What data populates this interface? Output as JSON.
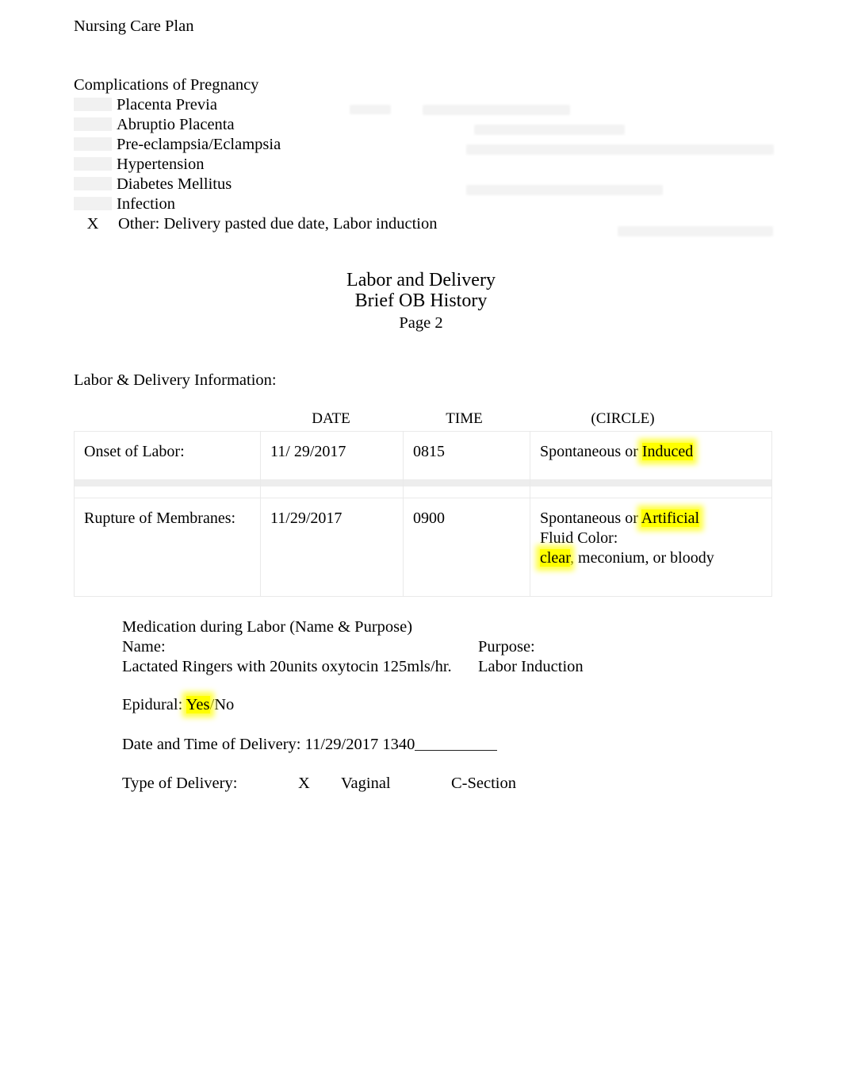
{
  "document": {
    "header": "Nursing Care Plan",
    "title_line_1": "Labor and Delivery",
    "title_line_2": "Brief OB History",
    "page_label": "Page 2"
  },
  "complications": {
    "heading": "Complications of Pregnancy",
    "items": [
      {
        "mark": "",
        "label": "Placenta Previa"
      },
      {
        "mark": "",
        "label": "Abruptio Placenta"
      },
      {
        "mark": "",
        "label": "Pre-eclampsia/Eclampsia"
      },
      {
        "mark": "",
        "label": "Hypertension"
      },
      {
        "mark": "",
        "label": "Diabetes Mellitus"
      },
      {
        "mark": "",
        "label": "Infection"
      }
    ],
    "other": {
      "mark": "X",
      "label": "Other: Delivery pasted due date, Labor induction"
    }
  },
  "labor_section": {
    "label": "Labor & Delivery Information:",
    "columns": [
      "",
      "DATE",
      "TIME",
      "(CIRCLE)"
    ],
    "rows": [
      {
        "name": "Onset of Labor:",
        "date": "11/ 29/2017",
        "time": "0815",
        "circle_prefix": "Spontaneous or ",
        "circle_highlight": "Induced",
        "extra_lines": []
      },
      {
        "name": "Rupture of Membranes:",
        "date": "11/29/2017",
        "time": "0900",
        "circle_prefix": "Spontaneous or ",
        "circle_highlight": "Artificial",
        "extra_lines": [
          "Fluid Color:",
          ", meconium, or bloody"
        ],
        "fluid_color_highlight": "clear"
      }
    ]
  },
  "medication": {
    "heading": "Medication during Labor (Name & Purpose)",
    "name_label": "Name:",
    "purpose_label": "Purpose:",
    "name_value": "Lactated Ringers with 20units oxytocin 125mls/hr.",
    "purpose_value": "Labor Induction"
  },
  "epidural": {
    "label": "Epidural: ",
    "selected": "Yes",
    "rest": "/No"
  },
  "delivery": {
    "datetime_label": "Date and Time of Delivery: ",
    "datetime_value": "11/29/2017 1340",
    "type_label": "Type of Delivery:",
    "type_mark": "X",
    "type_vaginal": "Vaginal",
    "type_csection": "C-Section"
  },
  "colors": {
    "highlight": "#ffff00",
    "text": "#000000",
    "table_border": "#e9e9e9",
    "blank_shading": "#f1f1f1"
  }
}
